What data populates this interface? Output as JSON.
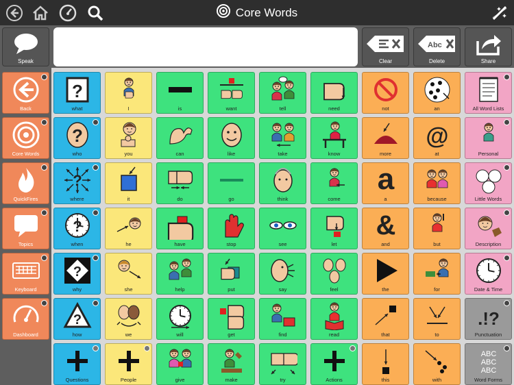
{
  "window": {
    "title": "Core Words"
  },
  "topbar_icons": [
    "back-circle-icon",
    "home-icon",
    "speedometer-icon",
    "search-icon",
    "edit-wand-icon"
  ],
  "toolbar": {
    "speak": {
      "label": "Speak",
      "icon": "speech-bubble-icon"
    },
    "message": "",
    "clear": {
      "label": "Clear",
      "icon": "clear-text-icon"
    },
    "delete": {
      "label": "Delete",
      "icon": "delete-word-icon",
      "glyph": "Abc"
    },
    "share": {
      "label": "Share",
      "icon": "share-icon"
    }
  },
  "nav": [
    {
      "label": "Back",
      "icon": "back-arrow-icon"
    },
    {
      "label": "Core Words",
      "icon": "target-icon"
    },
    {
      "label": "QuickFires",
      "icon": "flame-icon"
    },
    {
      "label": "Topics",
      "icon": "speech-bubble-icon"
    },
    {
      "label": "Keyboard",
      "icon": "keyboard-icon"
    },
    {
      "label": "Dashboard",
      "icon": "speedometer-icon"
    }
  ],
  "colors": {
    "blue": "#2cb6e6",
    "yellow": "#fbe77a",
    "green": "#3ee27e",
    "orange": "#fbae55",
    "pink": "#f2a5c5",
    "gray": "#9a9a9a",
    "nav": "#f0885a"
  },
  "rows": [
    [
      {
        "label": "what",
        "color": "blue",
        "icon": "question-box-icon"
      },
      {
        "label": "I",
        "color": "yellow",
        "icon": "person-self-icon"
      },
      {
        "label": "is",
        "color": "green",
        "icon": "dash-bar-icon"
      },
      {
        "label": "want",
        "color": "green",
        "icon": "want-hands-icon"
      },
      {
        "label": "tell",
        "color": "green",
        "icon": "tell-people-icon"
      },
      {
        "label": "need",
        "color": "green",
        "icon": "need-hand-icon"
      },
      {
        "label": "not",
        "color": "orange",
        "icon": "not-circle-icon"
      },
      {
        "label": "an",
        "color": "orange",
        "icon": "dots-icon"
      },
      {
        "label": "All Word Lists",
        "color": "pink",
        "icon": "notepad-icon",
        "badge": true
      }
    ],
    [
      {
        "label": "who",
        "color": "blue",
        "icon": "question-head-icon",
        "badge": true
      },
      {
        "label": "you",
        "color": "yellow",
        "icon": "pointing-person-icon"
      },
      {
        "label": "can",
        "color": "green",
        "icon": "strong-arm-icon"
      },
      {
        "label": "like",
        "color": "green",
        "icon": "smile-face-icon"
      },
      {
        "label": "take",
        "color": "green",
        "icon": "take-people-icon"
      },
      {
        "label": "know",
        "color": "green",
        "icon": "thinking-desk-icon"
      },
      {
        "label": "more",
        "color": "orange",
        "icon": "more-pile-icon"
      },
      {
        "label": "at",
        "color": "orange",
        "icon": "at-sign-icon"
      },
      {
        "label": "Personal",
        "color": "pink",
        "icon": "personal-person-icon",
        "badge": true
      }
    ],
    [
      {
        "label": "where",
        "color": "blue",
        "icon": "question-arrows-icon",
        "badge": true
      },
      {
        "label": "it",
        "color": "yellow",
        "icon": "blue-square-icon"
      },
      {
        "label": "do",
        "color": "green",
        "icon": "do-hands-icon"
      },
      {
        "label": "go",
        "color": "green",
        "icon": "go-arrow-icon"
      },
      {
        "label": "think",
        "color": "green",
        "icon": "think-head-icon"
      },
      {
        "label": "come",
        "color": "green",
        "icon": "come-person-icon"
      },
      {
        "label": "a",
        "color": "orange",
        "icon": "letter-a-icon",
        "glyph": "a"
      },
      {
        "label": "because",
        "color": "orange",
        "icon": "two-people-icon"
      },
      {
        "label": "Little Words",
        "color": "pink",
        "icon": "three-circles-icon",
        "badge": true
      }
    ],
    [
      {
        "label": "when",
        "color": "blue",
        "icon": "question-clock-icon",
        "badge": true
      },
      {
        "label": "he",
        "color": "yellow",
        "icon": "he-face-icon"
      },
      {
        "label": "have",
        "color": "green",
        "icon": "have-hands-icon"
      },
      {
        "label": "stop",
        "color": "green",
        "icon": "stop-hand-icon"
      },
      {
        "label": "see",
        "color": "green",
        "icon": "eyes-icon"
      },
      {
        "label": "let",
        "color": "green",
        "icon": "let-hand-icon"
      },
      {
        "label": "and",
        "color": "orange",
        "icon": "ampersand-icon",
        "glyph": "&"
      },
      {
        "label": "but",
        "color": "orange",
        "icon": "but-person-icon"
      },
      {
        "label": "Description",
        "color": "pink",
        "icon": "description-face-icon",
        "badge": true
      }
    ],
    [
      {
        "label": "why",
        "color": "blue",
        "icon": "question-diamond-icon",
        "badge": true
      },
      {
        "label": "she",
        "color": "yellow",
        "icon": "she-face-icon"
      },
      {
        "label": "help",
        "color": "green",
        "icon": "help-people-icon"
      },
      {
        "label": "put",
        "color": "green",
        "icon": "put-hands-icon"
      },
      {
        "label": "say",
        "color": "green",
        "icon": "say-face-icon"
      },
      {
        "label": "feel",
        "color": "green",
        "icon": "feel-faces-icon"
      },
      {
        "label": "the",
        "color": "orange",
        "icon": "play-triangle-icon"
      },
      {
        "label": "for",
        "color": "orange",
        "icon": "for-person-icon"
      },
      {
        "label": "Date & Time",
        "color": "pink",
        "icon": "date-clock-icon",
        "badge": true
      }
    ],
    [
      {
        "label": "how",
        "color": "blue",
        "icon": "question-triangle-icon",
        "badge": true
      },
      {
        "label": "we",
        "color": "yellow",
        "icon": "we-faces-icon"
      },
      {
        "label": "will",
        "color": "green",
        "icon": "will-clock-icon"
      },
      {
        "label": "get",
        "color": "green",
        "icon": "get-hands-icon"
      },
      {
        "label": "find",
        "color": "green",
        "icon": "find-person-icon"
      },
      {
        "label": "read",
        "color": "green",
        "icon": "read-book-icon"
      },
      {
        "label": "that",
        "color": "orange",
        "icon": "that-arrow-icon"
      },
      {
        "label": "to",
        "color": "orange",
        "icon": "to-arrows-icon"
      },
      {
        "label": "Punctuation",
        "color": "gray",
        "icon": "punctuation-icon",
        "glyph": ".!?",
        "badge": true
      }
    ],
    [
      {
        "label": "Questions",
        "color": "blue",
        "icon": "plus-icon",
        "undo": true
      },
      {
        "label": "People",
        "color": "yellow",
        "icon": "plus-icon",
        "undo": true
      },
      {
        "label": "give",
        "color": "green",
        "icon": "give-people-icon"
      },
      {
        "label": "make",
        "color": "green",
        "icon": "make-person-icon"
      },
      {
        "label": "try",
        "color": "green",
        "icon": "try-hands-icon"
      },
      {
        "label": "Actions",
        "color": "green",
        "icon": "plus-icon",
        "undo": true
      },
      {
        "label": "this",
        "color": "orange",
        "icon": "this-arrow-icon"
      },
      {
        "label": "with",
        "color": "orange",
        "icon": "with-dots-icon"
      },
      {
        "label": "Word Forms",
        "color": "gray",
        "icon": "word-forms-icon",
        "glyph": "ABC",
        "badge": true
      }
    ]
  ]
}
